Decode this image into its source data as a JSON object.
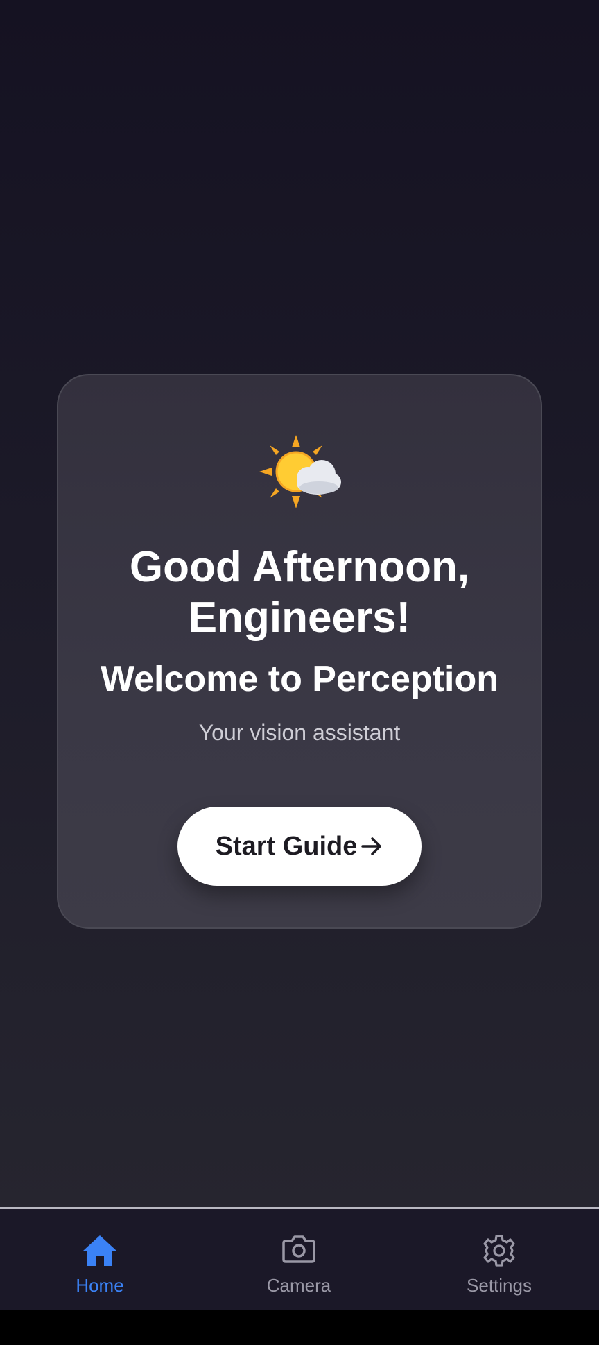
{
  "card": {
    "weather_icon": "sun-behind-cloud-icon",
    "greeting": "Good Afternoon,\nEngineers!",
    "welcome": "Welcome to Perception",
    "subtitle": "Your vision assistant",
    "start_button": {
      "label": "Start Guide",
      "icon": "arrow-right-icon"
    }
  },
  "tabbar": {
    "active": "Home",
    "items": [
      {
        "label": "Home",
        "icon": "home-icon"
      },
      {
        "label": "Camera",
        "icon": "camera-icon"
      },
      {
        "label": "Settings",
        "icon": "gear-icon"
      }
    ]
  },
  "colors": {
    "accent": "#3b82f6",
    "inactive_tab": "#9a98a6",
    "card_bg": "#3a3845",
    "button_bg": "#ffffff"
  }
}
